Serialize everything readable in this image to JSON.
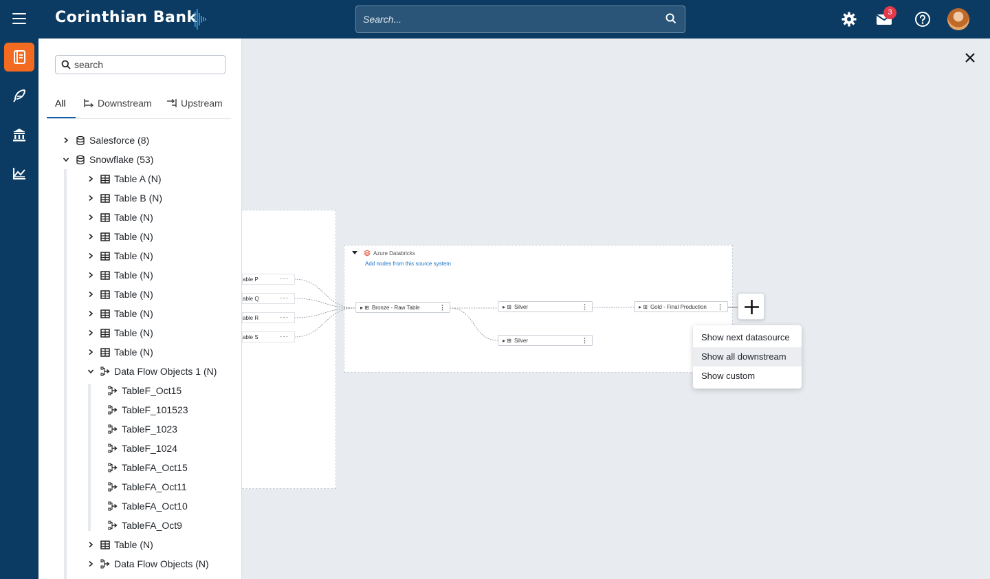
{
  "header": {
    "brand": "Corinthian Bank",
    "search_placeholder": "Search...",
    "notification_count": "3",
    "icons": [
      "hamburger-icon",
      "settings-icon",
      "mail-icon",
      "help-icon",
      "avatar"
    ]
  },
  "rail": {
    "items": [
      {
        "icon": "book-icon",
        "active": true
      },
      {
        "icon": "feather-icon",
        "active": false
      },
      {
        "icon": "bank-icon",
        "active": false
      },
      {
        "icon": "chart-icon",
        "active": false
      }
    ]
  },
  "panel": {
    "search_placeholder": "search",
    "tabs": [
      {
        "label": "All",
        "active": true
      },
      {
        "label": "Downstream",
        "icon": "downstream-icon"
      },
      {
        "label": "Upstream",
        "icon": "upstream-icon"
      }
    ],
    "tree": [
      {
        "label": "Salesforce (8)",
        "expanded": false,
        "icon": "database-icon"
      },
      {
        "label": "Snowflake (53)",
        "expanded": true,
        "icon": "database-icon"
      },
      {
        "label": "Table A (N)",
        "icon": "table-icon"
      },
      {
        "label": "Table B (N)",
        "icon": "table-icon"
      },
      {
        "label": "Table (N)",
        "icon": "table-icon"
      },
      {
        "label": "Table (N)",
        "icon": "table-icon"
      },
      {
        "label": "Table (N)",
        "icon": "table-icon"
      },
      {
        "label": "Table (N)",
        "icon": "table-icon"
      },
      {
        "label": "Table (N)",
        "icon": "table-icon"
      },
      {
        "label": "Table (N)",
        "icon": "table-icon"
      },
      {
        "label": "Table (N)",
        "icon": "table-icon"
      },
      {
        "label": "Table (N)",
        "icon": "table-icon"
      },
      {
        "label": "Data Flow Objects 1 (N)",
        "expanded": true,
        "icon": "dataflow-icon"
      },
      {
        "label": "TableF_Oct15",
        "icon": "dataflow-icon"
      },
      {
        "label": "TableF_101523",
        "icon": "dataflow-icon"
      },
      {
        "label": "TableF_1023",
        "icon": "dataflow-icon"
      },
      {
        "label": "TableF_1024",
        "icon": "dataflow-icon"
      },
      {
        "label": "TableFA_Oct15",
        "icon": "dataflow-icon"
      },
      {
        "label": "TableFA_Oct11",
        "icon": "dataflow-icon"
      },
      {
        "label": "TableFA_Oct10",
        "icon": "dataflow-icon"
      },
      {
        "label": "TableFA_Oct9",
        "icon": "dataflow-icon"
      },
      {
        "label": "Table (N)",
        "icon": "table-icon"
      },
      {
        "label": "Data Flow Objects (N)",
        "icon": "dataflow-icon"
      }
    ]
  },
  "canvas": {
    "left_nodes": [
      "able P",
      "able Q",
      "able R",
      "able S"
    ],
    "databricks": {
      "title": "Azure Databricks",
      "add_link": "Add nodes from this source system",
      "nodes": {
        "bronze": "Bronze - Raw Table",
        "silver_1": "Silver",
        "silver_2": "Silver",
        "gold": "Gold - Final Production"
      }
    },
    "menu": {
      "items": [
        "Show next datasource",
        "Show all downstream",
        "Show custom"
      ],
      "hovered": "Show all downstream"
    }
  }
}
